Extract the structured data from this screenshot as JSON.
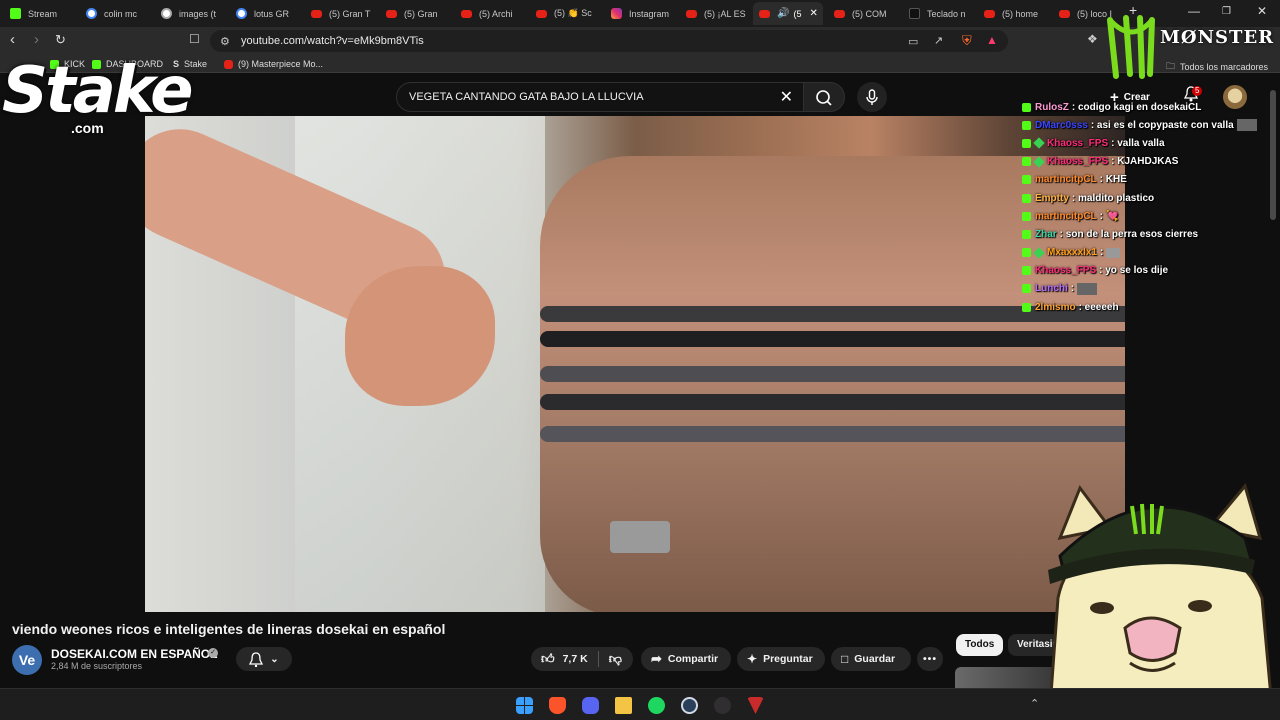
{
  "browser": {
    "tabs": [
      {
        "label": "Stream",
        "icon": "kick-icon"
      },
      {
        "label": "colin mc",
        "icon": "google-icon"
      },
      {
        "label": "images (t",
        "icon": "globe-icon"
      },
      {
        "label": "lotus GR",
        "icon": "google-icon"
      },
      {
        "label": "(5) Gran T",
        "icon": "youtube-icon"
      },
      {
        "label": "(5) Gran",
        "icon": "youtube-icon"
      },
      {
        "label": "(5) Archi",
        "icon": "youtube-icon"
      },
      {
        "label": "(5) 👏 Sc",
        "icon": "youtube-icon"
      },
      {
        "label": "Instagram",
        "icon": "instagram-icon"
      },
      {
        "label": "(5) ¡AL ES",
        "icon": "youtube-icon"
      },
      {
        "label": "(5",
        "icon": "youtube-icon",
        "active": true
      },
      {
        "label": "(5) COM",
        "icon": "youtube-icon"
      },
      {
        "label": "Teclado n",
        "icon": "tekno-icon"
      },
      {
        "label": "(5) home",
        "icon": "youtube-icon"
      },
      {
        "label": "(5) loco I",
        "icon": "youtube-icon"
      }
    ],
    "new_tab": "+",
    "window_controls": {
      "minimize": "—",
      "maximize": "❐",
      "close": "✕"
    },
    "url": "youtube.com/watch?v=eMk9bm8VTis",
    "bookmarks": [
      {
        "label": "KICK",
        "icon": "kick-icon"
      },
      {
        "label": "DASHBOARD",
        "icon": "kick-icon"
      },
      {
        "label": "Stake",
        "icon": "stake-icon"
      },
      {
        "label": "(9) Masterpiece Mo...",
        "icon": "youtube-icon"
      }
    ],
    "all_bookmarks": "Todos los marcadores"
  },
  "overlays": {
    "stake_logo": "Stake",
    "stake_domain": ".com",
    "monster_brand": "MØNSTER"
  },
  "youtube": {
    "search_query": "VEGETA CANTANDO GATA BAJO LA LLUCVIA",
    "create_label": "Crear",
    "notifications_count": "5",
    "video_title": "viendo weones ricos e inteligentes de lineras dosekai en español",
    "channel": {
      "avatar_text": "Ve",
      "name": "DOSEKAI.COM  EN ESPAÑOL",
      "verified": "✓",
      "subscribers": "2,84 M de suscriptores"
    },
    "actions": {
      "likes": "7,7 K",
      "share": "Compartir",
      "ask": "Preguntar",
      "save": "Guardar"
    },
    "chips": [
      "Todos",
      "Veritasium"
    ]
  },
  "chat": [
    {
      "user": "RulosZ",
      "color": "#ff9ad5",
      "msg": ": codigo kagi en dosekaiCL",
      "gem": false
    },
    {
      "user": "DMarc0sss",
      "color": "#3a46ff",
      "msg": ": asi es el copypaste con valla",
      "gem": false,
      "thumb": true
    },
    {
      "user": "Khaoss_FPS",
      "color": "#ff2c7a",
      "msg": ": valla valla",
      "gem": true
    },
    {
      "user": "Khaoss_FPS",
      "color": "#ff2c7a",
      "msg": ": KJAHDJKAS",
      "gem": true
    },
    {
      "user": "martincitpCL",
      "color": "#ff8a2a",
      "msg": ": KHE",
      "gem": false
    },
    {
      "user": "Emptty",
      "color": "#ffb347",
      "msg": ": maldito plastico",
      "gem": false
    },
    {
      "user": "martincitpCL",
      "color": "#ff8a2a",
      "msg": ":",
      "gem": false,
      "emote": "💘"
    },
    {
      "user": "Zhar",
      "color": "#3dd5a8",
      "msg": ": son de la perra esos cierres",
      "gem": false
    },
    {
      "user": "Mxaxxxlx1",
      "color": "#ff9f1a",
      "msg": ":",
      "gem": true,
      "thumb2": true
    },
    {
      "user": "Khaoss_FPS",
      "color": "#ff2c7a",
      "msg": ": yo se los dije",
      "gem": false
    },
    {
      "user": "Lunchi",
      "color": "#b26bff",
      "msg": ":",
      "gem": false,
      "thumb": true
    },
    {
      "user": "2lmismo",
      "color": "#ffa436",
      "msg": ": eeeeeh",
      "gem": false
    }
  ],
  "colors": {
    "kick_green": "#53fc18",
    "youtube_red": "#ff0000",
    "bg": "#0f0f0f",
    "pill": "#272727"
  },
  "taskbar": {
    "icons": [
      "windows-start-icon",
      "brave-icon",
      "discord-icon",
      "file-explorer-icon",
      "spotify-icon",
      "steam-icon",
      "obs-icon",
      "tekno-icon"
    ]
  }
}
